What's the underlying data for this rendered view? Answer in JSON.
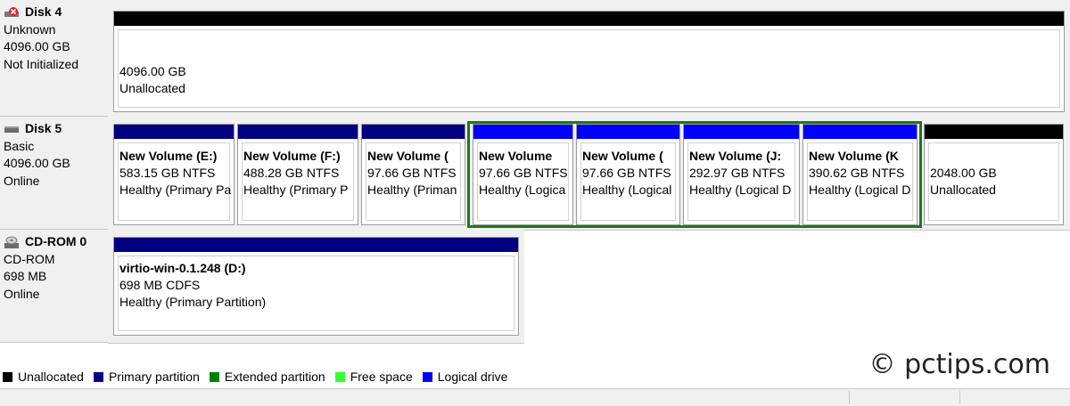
{
  "disks": [
    {
      "name": "Disk 4",
      "icon": "disk-error-icon",
      "lines": [
        "Unknown",
        "4096.00 GB",
        "Not Initialized"
      ],
      "partitions": [
        {
          "title": "",
          "lines": [
            "4096.00 GB",
            "Unallocated"
          ],
          "color": "#000000"
        }
      ]
    },
    {
      "name": "Disk 5",
      "icon": "disk-icon",
      "lines": [
        "Basic",
        "4096.00 GB",
        "Online"
      ],
      "partitions": [
        {
          "title": "New Volume  (E:)",
          "lines": [
            "583.15 GB NTFS",
            "Healthy (Primary Pa"
          ],
          "color": "#000080"
        },
        {
          "title": "New Volume  (F:)",
          "lines": [
            "488.28 GB NTFS",
            "Healthy (Primary P"
          ],
          "color": "#000080"
        },
        {
          "title": "New Volume  (",
          "lines": [
            "97.66 GB NTFS",
            "Healthy (Priman"
          ],
          "color": "#000080"
        },
        {
          "title": "New Volume",
          "lines": [
            "97.66 GB NTFS",
            "Healthy (Logica"
          ],
          "color": "#0000ff"
        },
        {
          "title": "New Volume  (",
          "lines": [
            "97.66 GB NTFS",
            "Healthy (Logical"
          ],
          "color": "#0000ff"
        },
        {
          "title": "New Volume  (J:",
          "lines": [
            "292.97 GB NTFS",
            "Healthy (Logical D"
          ],
          "color": "#0000ff"
        },
        {
          "title": "New Volume  (K",
          "lines": [
            "390.62 GB NTFS",
            "Healthy (Logical D"
          ],
          "color": "#0000ff"
        },
        {
          "title": "",
          "lines": [
            "2048.00 GB",
            "Unallocated"
          ],
          "color": "#000000"
        }
      ]
    },
    {
      "name": "CD-ROM 0",
      "icon": "cdrom-icon",
      "lines": [
        "CD-ROM",
        "698 MB",
        "Online"
      ],
      "partitions": [
        {
          "title": "virtio-win-0.1.248  (D:)",
          "lines": [
            "698 MB CDFS",
            "Healthy (Primary Partition)"
          ],
          "color": "#000080"
        }
      ]
    }
  ],
  "legend": [
    {
      "label": "Unallocated",
      "color": "#000000"
    },
    {
      "label": "Primary partition",
      "color": "#000080"
    },
    {
      "label": "Extended partition",
      "color": "#008000"
    },
    {
      "label": "Free space",
      "color": "#33ff33"
    },
    {
      "label": "Logical drive",
      "color": "#0000ff"
    }
  ],
  "watermark": "© pctips.com"
}
